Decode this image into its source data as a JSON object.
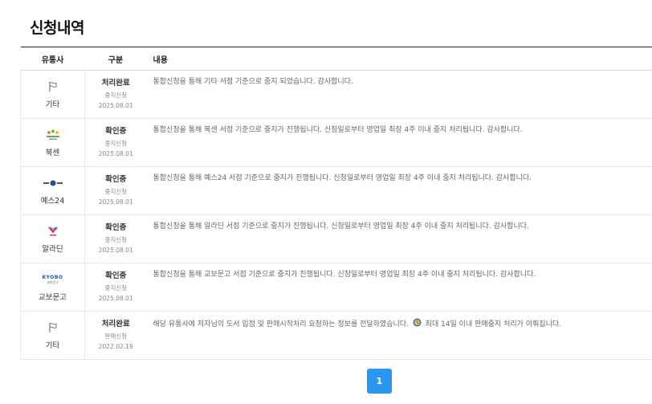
{
  "page": {
    "title": "신청내역"
  },
  "table": {
    "headers": {
      "vendor": "유통사",
      "kind": "구분",
      "content": "내용"
    },
    "rows": [
      {
        "vendor": "기타",
        "logo": "flag-icon",
        "status": "처리완료",
        "type": "중지신청",
        "date": "2025.08.01",
        "content": "통합신청을 통해 기타 서점 기준으로 중지 되었습니다. 감사합니다."
      },
      {
        "vendor": "북센",
        "logo": "booxen-logo",
        "status": "확인중",
        "type": "중지신청",
        "date": "2025.08.01",
        "content": "통합신청을 통해 북센 서점 기준으로 중지가 진행됩니다. 신청일로부터 영업일 최장 4주 이내 중지 처리됩니다. 감사합니다."
      },
      {
        "vendor": "예스24",
        "logo": "yes24-logo",
        "status": "확인중",
        "type": "중지신청",
        "date": "2025.08.01",
        "content": "통합신청을 통해 예스24 서점 기준으로 중지가 진행됩니다. 신청일로부터 영업일 최장 4주 이내 중지 처리됩니다. 감사합니다."
      },
      {
        "vendor": "알라딘",
        "logo": "aladin-logo",
        "status": "확인중",
        "type": "중지신청",
        "date": "2025.08.01",
        "content": "통합신청을 통해 알라딘 서점 기준으로 중지가 진행됩니다. 신청일로부터 영업일 최장 4주 이내 중지 처리됩니다. 감사합니다."
      },
      {
        "vendor": "교보문고",
        "logo": "kyobo-logo",
        "status": "확인중",
        "type": "중지신청",
        "date": "2025.08.01",
        "content": "통합신청을 통해 교보문고 서점 기준으로 중지가 진행됩니다. 신청일로부터 영업일 최장 4주 이내 중지 처리됩니다. 감사합니다."
      },
      {
        "vendor": "기타",
        "logo": "flag-icon",
        "status": "처리완료",
        "type": "판매신청",
        "date": "2022.02.19",
        "content": "해당 유통사에 저자님의 도서 입점 및 판매시작처리 요청하는 정보를 전달하였습니다.",
        "content_emoji": "clock-icon",
        "content_tail": "최대 14일 이내 판매중지 처리가 이뤄집니다."
      }
    ]
  },
  "kyobo_logo_text": {
    "top": "KYOBO",
    "bottom": "교보문고"
  },
  "pagination": {
    "current": "1"
  },
  "colors": {
    "accent": "#2997f0",
    "header_border": "#222222"
  }
}
